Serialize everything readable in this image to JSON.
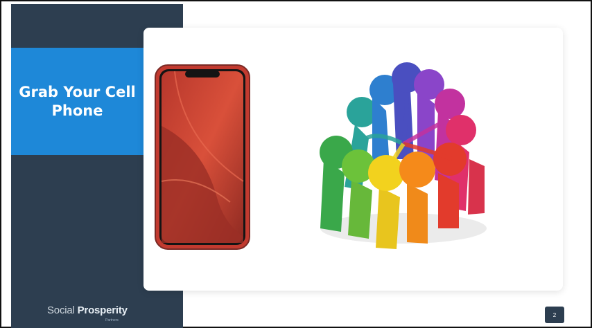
{
  "slide": {
    "title": "Grab Your Cell Phone",
    "brand_light": "Social ",
    "brand_bold": "Prosperity",
    "brand_sub": "Partners",
    "page_number": "2"
  },
  "colors": {
    "sidebar": "#2d3e50",
    "title_box": "#1e88d8",
    "phone_body": "#c23a2f"
  },
  "images": {
    "phone": "red-smartphone-image",
    "people": "colorful-people-circle-image"
  }
}
